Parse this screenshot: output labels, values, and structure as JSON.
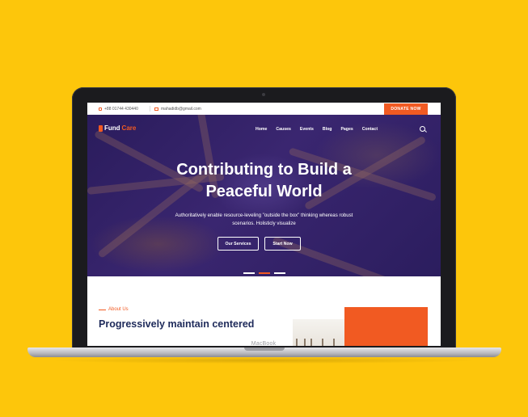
{
  "topbar": {
    "phone": "+88 01744 430440",
    "email": "mahadidb@gmail.com",
    "donate_label": "DONATE NOW"
  },
  "nav": {
    "logo": {
      "prefix": "Fund",
      "accent": "Care"
    },
    "items": [
      "Home",
      "Causes",
      "Events",
      "Blog",
      "Pages",
      "Contact"
    ]
  },
  "hero": {
    "title_line1": "Contributing to Build a",
    "title_line2": "Peaceful World",
    "lead_line1": "Authoritatively enable resource-leveling \"outside the box\" thinking whereas robust",
    "lead_line2": "scenarios. Holisticly visualize",
    "btn_services": "Our Services",
    "btn_start": "Start Now",
    "slide_index": 1,
    "slide_count": 3
  },
  "about": {
    "label": "About Us",
    "title": "Progressively maintain centered"
  },
  "device": {
    "brand": "MacBook"
  },
  "colors": {
    "background": "#FDC60B",
    "accent": "#f15a22",
    "hero": "#2e1f63"
  }
}
